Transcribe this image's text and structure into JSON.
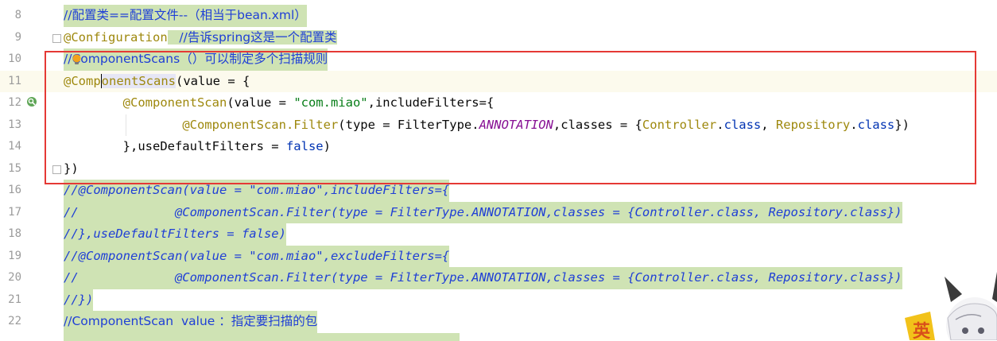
{
  "editor": {
    "lines": [
      {
        "no": "8",
        "text": "//配置类==配置文件--（相当于bean.xml）"
      },
      {
        "no": "9",
        "annotation": "@Configuration",
        "comment": "   //告诉spring这是一个配置类"
      },
      {
        "no": "10",
        "text": "//ComponentScans（）可以制定多个扫描规则"
      },
      {
        "no": "11",
        "a1": "@Comp",
        "a2": "onentScans",
        "rest": "(value = {"
      },
      {
        "no": "12",
        "indent": "        ",
        "annotation": "@ComponentScan",
        "p1": "(value = ",
        "str": "\"com.miao\"",
        "p2": ",includeFilters={"
      },
      {
        "no": "13",
        "indent": "                ",
        "annotation": "@ComponentScan.Filter",
        "p1": "(type = FilterType.",
        "const": "ANNOTATION",
        "p2": ",classes = {",
        "c1": "Controller",
        "dot1": ".",
        "k1": "class",
        "sep": ", ",
        "c2": "Repository",
        "dot2": ".",
        "k2": "class",
        "p3": "})"
      },
      {
        "no": "14",
        "indent": "        ",
        "p1": "},useDefaultFilters = ",
        "kw": "false",
        "p2": ")"
      },
      {
        "no": "15",
        "text": "})"
      },
      {
        "no": "16",
        "text": "//@ComponentScan(value = \"com.miao\",includeFilters={"
      },
      {
        "no": "17",
        "text": "//             @ComponentScan.Filter(type = FilterType.ANNOTATION,classes = {Controller.class, Repository.class})"
      },
      {
        "no": "18",
        "text": "//},useDefaultFilters = false)"
      },
      {
        "no": "19",
        "text": "//@ComponentScan(value = \"com.miao\",excludeFilters={"
      },
      {
        "no": "20",
        "text": "//             @ComponentScan.Filter(type = FilterType.ANNOTATION,classes = {Controller.class, Repository.class})"
      },
      {
        "no": "21",
        "text": "//})"
      },
      {
        "no": "22",
        "text": "//ComponentScan  value ：指定要扫描的包"
      }
    ]
  },
  "overlay": {
    "box_color": "#e53935",
    "mascot_glyph": "英"
  },
  "icons": {
    "intention": "lightbulb-icon",
    "spring": "spring-bean-gutter-icon",
    "fold": "fold-marker-icon"
  },
  "colors": {
    "comment_highlight": "#cfe3b4",
    "annotation": "#9e880d",
    "string": "#067d17",
    "keyword": "#0033b3",
    "comment": "#1f3fd6"
  }
}
